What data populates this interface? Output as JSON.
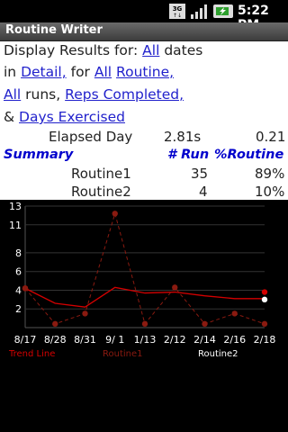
{
  "status": {
    "time": "5:22 PM",
    "network": "3G"
  },
  "app": {
    "title": "Routine Writer"
  },
  "filters": {
    "line1_prefix": "Display Results for:",
    "dates_link": "All",
    "dates_suffix": "dates",
    "line2_in": "in",
    "detail_link": "Detail,",
    "line2_for": "for",
    "routine_all_link": "All",
    "routine_link": "Routine,",
    "runs_all_link": "All",
    "runs_text": "runs,",
    "reps_link": "Reps Completed,",
    "amp": "&",
    "days_link": "Days Exercised"
  },
  "elapsed": {
    "label": "Elapsed Day",
    "value": "2.81s",
    "value2": "0.21"
  },
  "summary": {
    "label": "Summary",
    "col_run": "# Run",
    "col_pct": "%Routine",
    "rows": [
      {
        "name": "Routine1",
        "runs": "35",
        "pct": "89%"
      },
      {
        "name": "Routine2",
        "runs": "4",
        "pct": "10%"
      }
    ]
  },
  "legend": {
    "trend": "Trend Line",
    "routine1": "Routine1",
    "routine2": "Routine2"
  },
  "colors": {
    "trend": "#d40000",
    "routine1": "#8a1a10",
    "routine2": "#ffffff",
    "link": "#2222cc",
    "summary": "#0000cc"
  },
  "chart_data": {
    "type": "line",
    "x": [
      "8/17",
      "8/28",
      "8/31",
      "9/ 1",
      "1/13",
      "2/12",
      "2/14",
      "2/16",
      "2/18"
    ],
    "yticks": [
      "13",
      "11",
      "8",
      "6",
      "4",
      "2"
    ],
    "ylim": [
      0,
      13
    ],
    "series": [
      {
        "name": "Trend Line",
        "values": [
          4.2,
          2.6,
          2.2,
          4.3,
          3.7,
          3.8,
          3.4,
          3.1,
          3.1
        ]
      },
      {
        "name": "Routine1",
        "values": [
          4.2,
          0.4,
          1.5,
          12.2,
          0.4,
          4.3,
          0.4,
          1.5,
          0.4
        ]
      },
      {
        "name": "Routine2",
        "values": [
          null,
          null,
          null,
          null,
          null,
          null,
          null,
          null,
          3.0
        ]
      }
    ],
    "end_markers": {
      "trend": 3.8,
      "routine2": 3.0
    }
  }
}
